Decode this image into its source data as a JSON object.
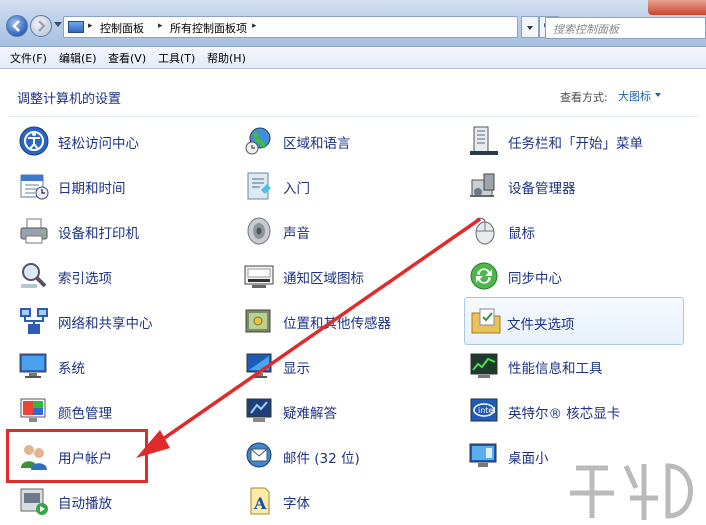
{
  "titlebar": {
    "breadcrumb": [
      "控制面板",
      "所有控制面板项"
    ],
    "search_placeholder": "搜索控制面板"
  },
  "menu": [
    {
      "label": "文件(F)"
    },
    {
      "label": "编辑(E)"
    },
    {
      "label": "查看(V)"
    },
    {
      "label": "工具(T)"
    },
    {
      "label": "帮助(H)"
    }
  ],
  "header": {
    "title": "调整计算机的设置",
    "view_by_label": "查看方式:",
    "view_by_value": "大图标"
  },
  "items": [
    {
      "label": "轻松访问中心",
      "icon": "ease-of-access-icon"
    },
    {
      "label": "日期和时间",
      "icon": "calendar-clock-icon"
    },
    {
      "label": "设备和打印机",
      "icon": "printer-icon"
    },
    {
      "label": "索引选项",
      "icon": "indexing-search-icon"
    },
    {
      "label": "网络和共享中心",
      "icon": "network-icon"
    },
    {
      "label": "系统",
      "icon": "computer-monitor-icon"
    },
    {
      "label": "颜色管理",
      "icon": "color-management-icon"
    },
    {
      "label": "用户帐户",
      "icon": "user-accounts-icon"
    },
    {
      "label": "自动播放",
      "icon": "autoplay-icon"
    },
    {
      "label": "区域和语言",
      "icon": "globe-clock-icon"
    },
    {
      "label": "入门",
      "icon": "getting-started-icon"
    },
    {
      "label": "声音",
      "icon": "speaker-icon"
    },
    {
      "label": "通知区域图标",
      "icon": "notification-tray-icon"
    },
    {
      "label": "位置和其他传感器",
      "icon": "location-sensor-icon"
    },
    {
      "label": "显示",
      "icon": "display-icon"
    },
    {
      "label": "疑难解答",
      "icon": "troubleshooting-icon"
    },
    {
      "label": "邮件 (32 位)",
      "icon": "mail-icon"
    },
    {
      "label": "字体",
      "icon": "fonts-icon"
    },
    {
      "label": "任务栏和「开始」菜单",
      "icon": "taskbar-icon"
    },
    {
      "label": "设备管理器",
      "icon": "device-manager-icon"
    },
    {
      "label": "鼠标",
      "icon": "mouse-icon"
    },
    {
      "label": "同步中心",
      "icon": "sync-icon"
    },
    {
      "label": "文件夹选项",
      "icon": "folder-options-icon"
    },
    {
      "label": "性能信息和工具",
      "icon": "performance-icon"
    },
    {
      "label": "英特尔® 核芯显卡",
      "icon": "intel-graphics-icon"
    },
    {
      "label": "桌面小",
      "icon": "desktop-gadgets-icon"
    }
  ],
  "colors": {
    "link": "#1e3287",
    "annotation_red": "#e02b2b"
  }
}
